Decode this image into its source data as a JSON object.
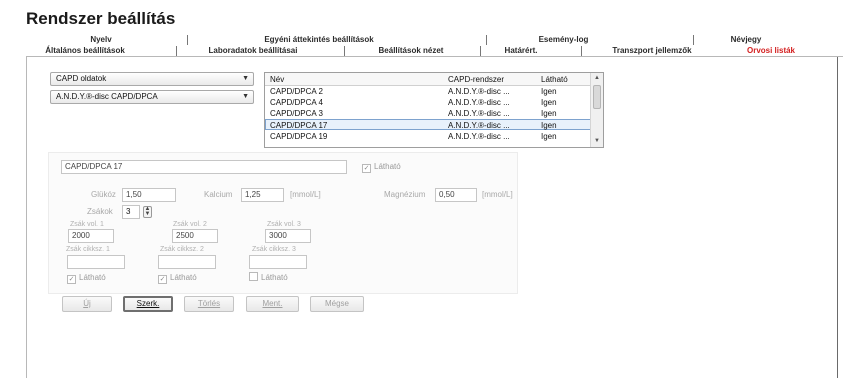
{
  "page": {
    "title": "Rendszer beállítás"
  },
  "tabs": {
    "row1": [
      "Nyelv",
      "Egyéni áttekintés beállítások",
      "Esemény-log",
      "Névjegy"
    ],
    "row2": [
      "Általános beállítások",
      "Laboradatok beállításai",
      "Beállítások nézet",
      "Határért.",
      "Transzport jellemzők",
      "Orvosi listák"
    ],
    "active": "Orvosi listák"
  },
  "selectors": {
    "list_type": "CAPD oldatok",
    "system": "A.N.D.Y.®-disc CAPD/DPCA"
  },
  "list": {
    "columns": [
      "Név",
      "CAPD-rendszer",
      "Látható"
    ],
    "rows": [
      {
        "name": "CAPD/DPCA 2",
        "system": "A.N.D.Y.®-disc ...",
        "visible": "Igen"
      },
      {
        "name": "CAPD/DPCA 4",
        "system": "A.N.D.Y.®-disc ...",
        "visible": "Igen"
      },
      {
        "name": "CAPD/DPCA 3",
        "system": "A.N.D.Y.®-disc ...",
        "visible": "Igen"
      },
      {
        "name": "CAPD/DPCA 17",
        "system": "A.N.D.Y.®-disc ...",
        "visible": "Igen"
      },
      {
        "name": "CAPD/DPCA 19",
        "system": "A.N.D.Y.®-disc ...",
        "visible": "Igen"
      }
    ],
    "selected_index": 3
  },
  "detail": {
    "name_value": "CAPD/DPCA 17",
    "visible_label": "Látható",
    "glucose_label": "Glükóz",
    "glucose_value": "1,50",
    "calcium_label": "Kalcium",
    "calcium_value": "1,25",
    "calcium_unit": "[mmol/L]",
    "magnesium_label": "Magnézium",
    "magnesium_value": "0,50",
    "magnesium_unit": "[mmol/L]",
    "bags_label": "Zsákok",
    "bags_value": "3",
    "bag_vol_1_label": "Zsák vol. 1",
    "bag_vol_1_value": "2000",
    "bag_vol_2_label": "Zsák vol. 2",
    "bag_vol_2_value": "2500",
    "bag_vol_3_label": "Zsák vol. 3",
    "bag_vol_3_value": "3000",
    "bag_item_1_label": "Zsák cikksz. 1",
    "bag_item_2_label": "Zsák cikksz. 2",
    "bag_item_3_label": "Zsák cikksz. 3",
    "bag_item_1_value": "",
    "bag_item_2_value": "",
    "bag_item_3_value": "",
    "bag_visible_label": "Látható"
  },
  "buttons": {
    "new": "Új",
    "edit": "Szerk.",
    "delete": "Törlés",
    "save": "Ment.",
    "cancel": "Mégse"
  }
}
